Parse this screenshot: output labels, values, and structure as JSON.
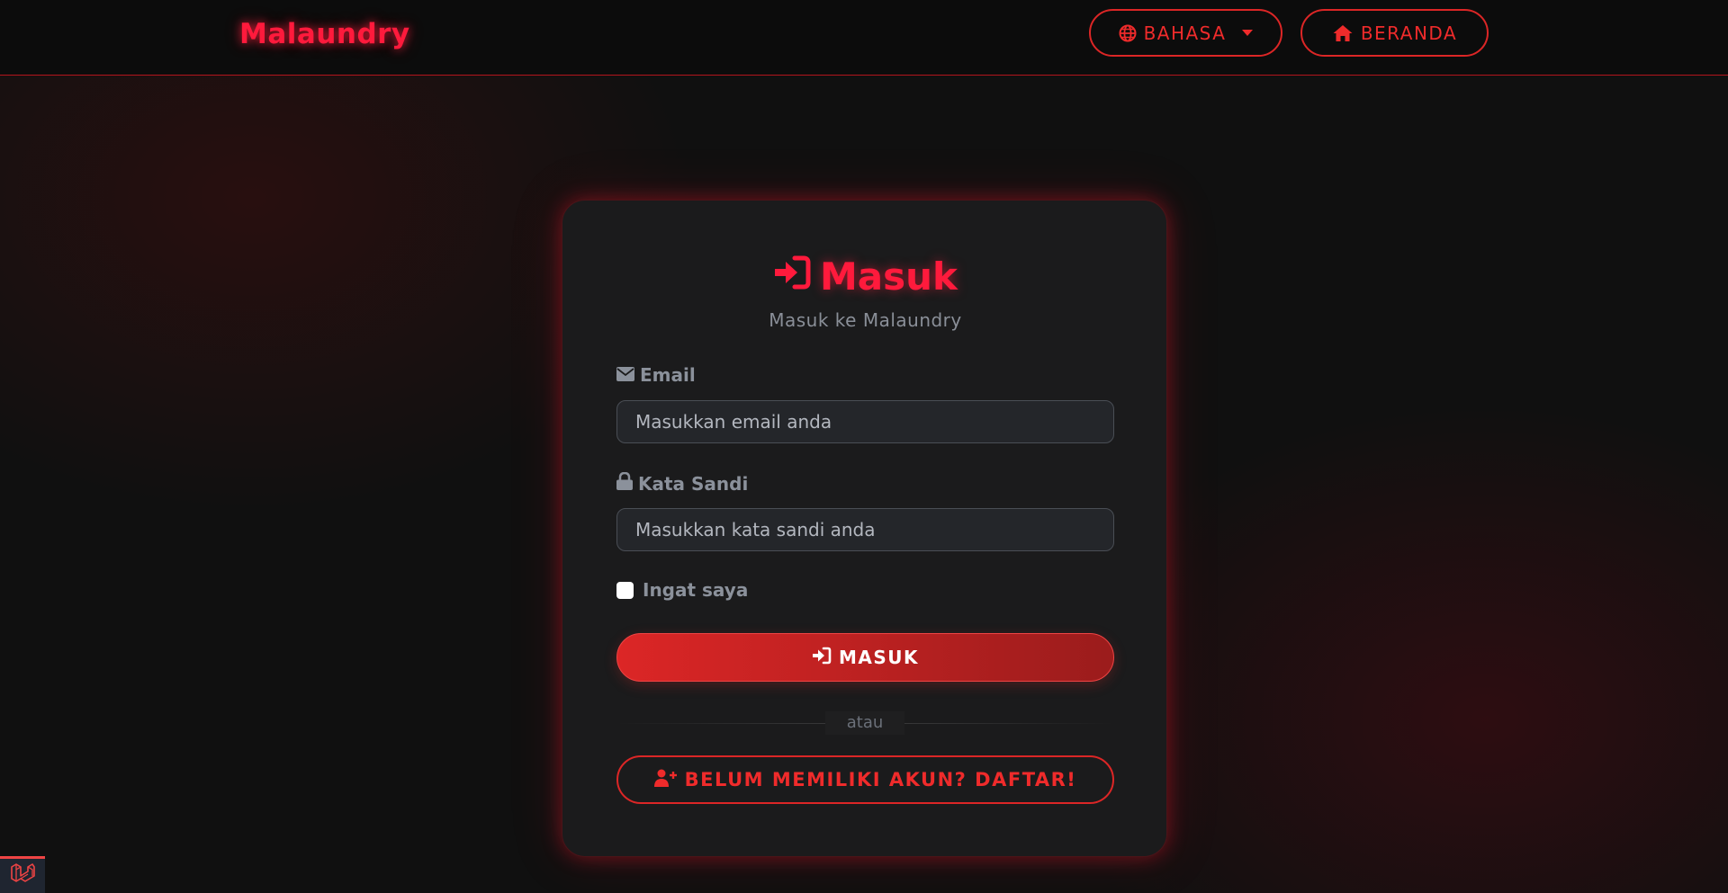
{
  "colors": {
    "accent": "#dc2626",
    "brand_glow": "#ff1a3c",
    "background": "#101010",
    "card": "#1b1b1c",
    "muted_text": "#8b919b"
  },
  "navbar": {
    "brand": "Malaundry",
    "language_button": {
      "label": "BAHASA",
      "icon": "globe-icon"
    },
    "home_button": {
      "label": "BERANDA",
      "icon": "home-icon"
    }
  },
  "login_card": {
    "title": "Masuk",
    "title_icon": "sign-in-icon",
    "subtitle": "Masuk ke Malaundry",
    "email": {
      "label": "Email",
      "icon": "envelope-icon",
      "placeholder": "Masukkan email anda",
      "value": ""
    },
    "password": {
      "label": "Kata Sandi",
      "icon": "lock-icon",
      "placeholder": "Masukkan kata sandi anda",
      "value": ""
    },
    "remember": {
      "label": "Ingat saya",
      "checked": false
    },
    "submit_label": "MASUK",
    "divider_text": "atau",
    "register_label": "BELUM MEMILIKI AKUN? DAFTAR!",
    "register_icon": "user-plus-icon"
  },
  "debug_toolbar": {
    "icon": "laravel-icon"
  }
}
